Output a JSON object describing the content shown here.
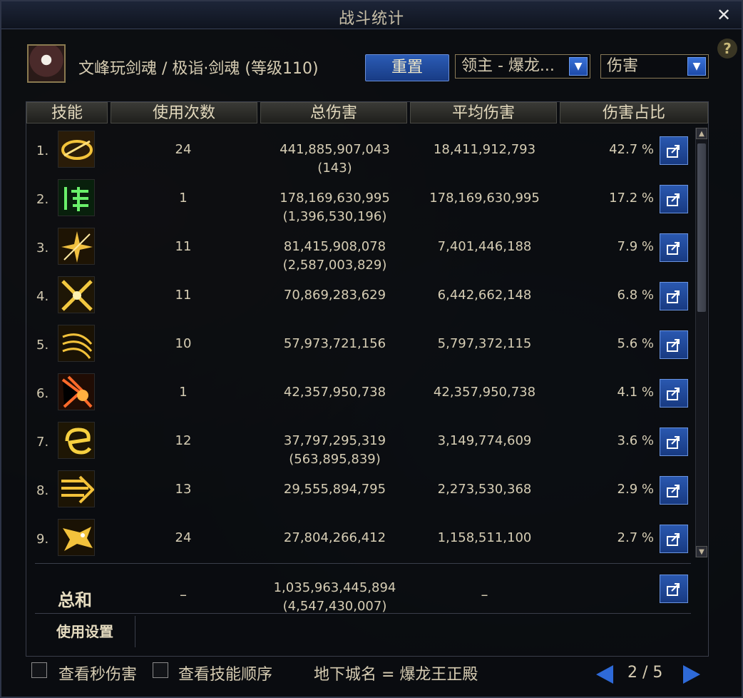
{
  "window": {
    "title": "战斗统计"
  },
  "character": {
    "line": "文峰玩剑魂 / 极诣·剑魂 (等级110)"
  },
  "controls": {
    "reset_label": "重置",
    "boss_select": "领主 - 爆龙...",
    "type_select": "伤害"
  },
  "table": {
    "headers": [
      "技能",
      "使用次数",
      "总伤害",
      "平均伤害",
      "伤害占比"
    ],
    "rows": [
      {
        "idx": "1.",
        "uses": "24",
        "total": "441,885,907,043",
        "total_sub": "(143)",
        "avg": "18,411,912,793",
        "pct": "42.7 %",
        "icon": "golden-slash-ring-icon"
      },
      {
        "idx": "2.",
        "uses": "1",
        "total": "178,169,630,995",
        "total_sub": "(1,396,530,196)",
        "avg": "178,169,630,995",
        "pct": "17.2 %",
        "icon": "green-sword-art-icon"
      },
      {
        "idx": "3.",
        "uses": "11",
        "total": "81,415,908,078",
        "total_sub": "(2,587,003,829)",
        "avg": "7,401,446,188",
        "pct": "7.9 %",
        "icon": "spark-burst-icon"
      },
      {
        "idx": "4.",
        "uses": "11",
        "total": "70,869,283,629",
        "total_sub": "",
        "avg": "6,442,662,148",
        "pct": "6.8 %",
        "icon": "crossed-blade-icon"
      },
      {
        "idx": "5.",
        "uses": "10",
        "total": "57,973,721,156",
        "total_sub": "",
        "avg": "5,797,372,115",
        "pct": "5.6 %",
        "icon": "wind-slash-icon"
      },
      {
        "idx": "6.",
        "uses": "1",
        "total": "42,357,950,738",
        "total_sub": "",
        "avg": "42,357,950,738",
        "pct": "4.1 %",
        "icon": "fire-burst-icon"
      },
      {
        "idx": "7.",
        "uses": "12",
        "total": "37,797,295,319",
        "total_sub": "(563,895,839)",
        "avg": "3,149,774,609",
        "pct": "3.6 %",
        "icon": "golden-swirl-icon"
      },
      {
        "idx": "8.",
        "uses": "13",
        "total": "29,555,894,795",
        "total_sub": "",
        "avg": "2,273,530,368",
        "pct": "2.9 %",
        "icon": "dash-strike-icon"
      },
      {
        "idx": "9.",
        "uses": "24",
        "total": "27,804,266,412",
        "total_sub": "",
        "avg": "1,158,511,100",
        "pct": "2.7 %",
        "icon": "dragon-head-icon"
      }
    ],
    "total": {
      "label": "总和",
      "uses": "–",
      "damage": "1,035,963,445,894",
      "damage_sub": "(4,547,430,007)",
      "avg": "–"
    },
    "usage_settings": "使用设置"
  },
  "footer": {
    "cb_per_second": "查看秒伤害",
    "cb_skill_order": "查看技能顺序",
    "dungeon": "地下城名 = 爆龙王正殿",
    "page": "2 / 5"
  },
  "colors": {
    "accent_blue": "#2a58b0",
    "text_gold": "#d6ccb2",
    "background": "#0b0d12"
  }
}
